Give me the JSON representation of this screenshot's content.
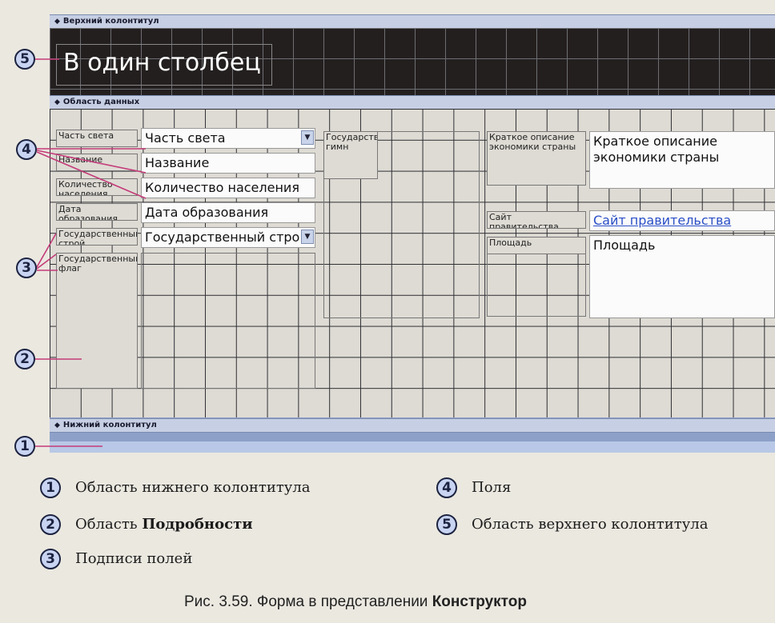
{
  "bands": {
    "header": "Верхний колонтитул",
    "detail": "Область данных",
    "footer": "Нижний колонтитул"
  },
  "header_title": "В один столбец",
  "labels": {
    "part_of_world": "Часть света",
    "name": "Название",
    "population": "Количество населения",
    "founded": "Дата образования",
    "government": "Государственный строй",
    "flag": "Государственный флаг",
    "anthem": "Государственный гимн",
    "economy": "Краткое описание экономики страны",
    "website": "Сайт правительства",
    "area": "Площадь"
  },
  "fields": {
    "part_of_world": "Часть света",
    "name": "Название",
    "population": "Количество населения",
    "founded": "Дата образования",
    "government": "Государственный стро",
    "economy": "Краткое описание экономики страны",
    "website": "Сайт правительства",
    "area": "Площадь"
  },
  "callouts": [
    "1",
    "2",
    "3",
    "4",
    "5"
  ],
  "legend": {
    "item1_text": "Область нижнего колонтитула",
    "item2_prefix": "Область ",
    "item2_bold": "Подробности",
    "item3_text": "Подписи полей",
    "item4_text": "Поля",
    "item5_text": "Область верхнего колонтитула"
  },
  "caption": {
    "prefix": "Рис. 3.59. Форма в представлении ",
    "bold": "Конструктор"
  },
  "colors": {
    "accent": "#8da0c8",
    "header_bg": "#241f1f",
    "detail_bg": "#dedbd4",
    "link": "#2a4fc7"
  }
}
